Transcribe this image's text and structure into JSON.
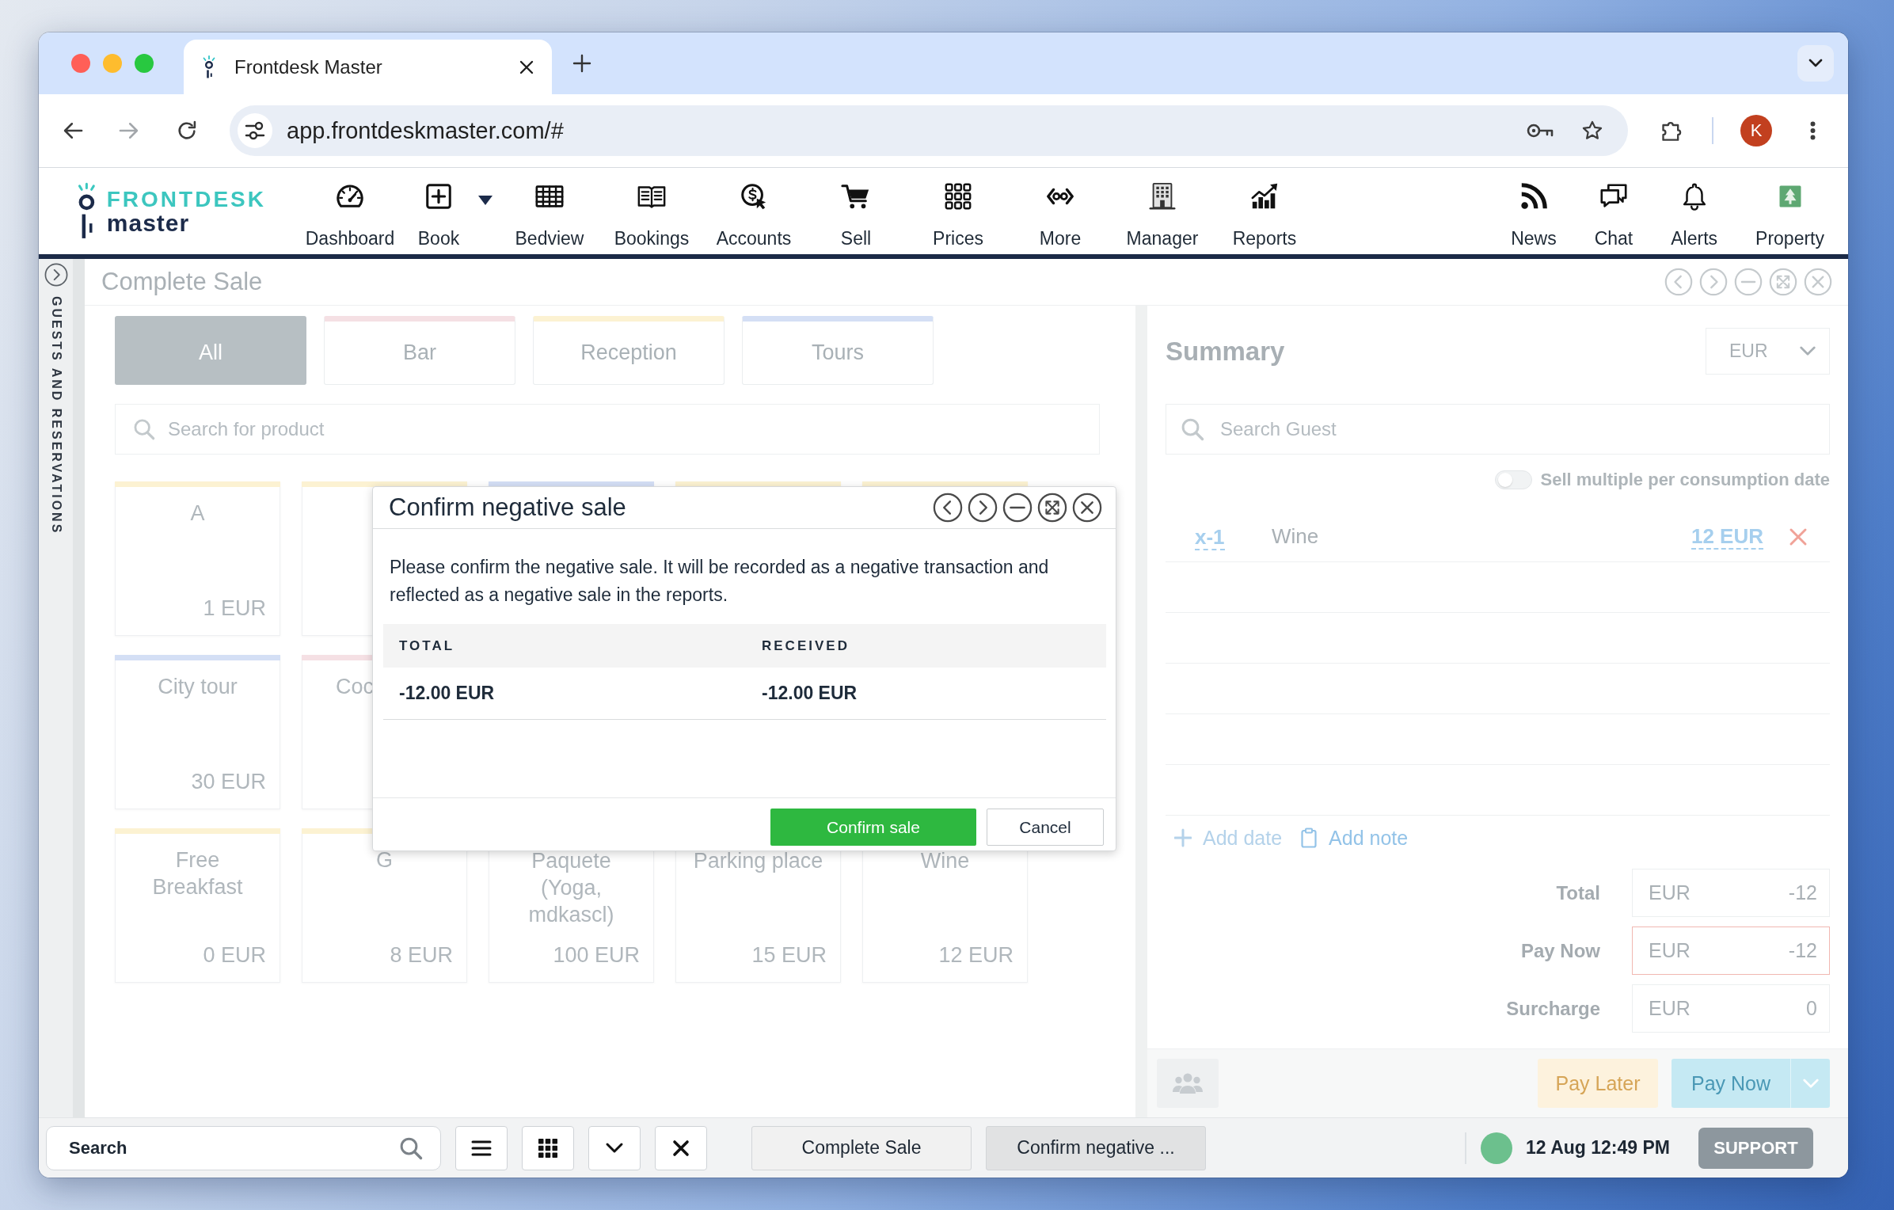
{
  "browser": {
    "tabs": [
      {
        "title": "Frontdesk Master",
        "selected": true
      }
    ],
    "url": "app.frontdeskmaster.com/#",
    "profile_initial": "K"
  },
  "navbar": {
    "logo": {
      "name": "FRONTDESK",
      "tagline": "master"
    },
    "items": [
      {
        "label": "Dashboard",
        "dropdown": false
      },
      {
        "label": "Book",
        "dropdown": true
      },
      {
        "label": "Bedview",
        "dropdown": false
      },
      {
        "label": "Bookings",
        "dropdown": false
      },
      {
        "label": "Accounts",
        "dropdown": false
      },
      {
        "label": "Sell",
        "dropdown": false
      },
      {
        "label": "Prices",
        "dropdown": false
      },
      {
        "label": "More",
        "dropdown": false
      },
      {
        "label": "Manager",
        "dropdown": false
      },
      {
        "label": "Reports",
        "dropdown": false
      }
    ],
    "right_items": [
      {
        "label": "News"
      },
      {
        "label": "Chat"
      },
      {
        "label": "Alerts"
      },
      {
        "label": "Property"
      }
    ]
  },
  "sidebar": {
    "label": "GUESTS AND RESERVATIONS"
  },
  "sale_panel": {
    "title": "Complete Sale",
    "categories": [
      {
        "label": "All",
        "selected": true
      },
      {
        "label": "Bar",
        "selected": false,
        "color": "#f5e0e4"
      },
      {
        "label": "Reception",
        "selected": false,
        "color": "#fcf2d2"
      },
      {
        "label": "Tours",
        "selected": false,
        "color": "#d4dff5"
      }
    ],
    "search": {
      "placeholder": "Search for product"
    },
    "product_rows": [
      [
        {
          "name": "A",
          "price": "1 EUR",
          "color": "#fcf2d2"
        },
        {
          "color": "#fcf2d2"
        },
        {
          "color": "#d4dff5"
        },
        {
          "color": "#fcf2d2"
        },
        {
          "color": "#fcf2d2"
        }
      ],
      [
        {
          "name": "City tour",
          "price": "30 EUR",
          "color": "#d4dff5"
        },
        {
          "name": "Coc",
          "color": "#f5e0e4"
        }
      ],
      [
        {
          "name": "Free Breakfast",
          "price": "0 EUR",
          "color": "#fcf2d2"
        },
        {
          "name": "G",
          "price": "8 EUR",
          "color": "#fcf2d2"
        },
        {
          "name": "Paquete (Yoga, mdkascl)",
          "price": "100 EUR"
        },
        {
          "name": "Parking place",
          "price": "15 EUR"
        },
        {
          "name": "Wine",
          "price": "12 EUR"
        }
      ]
    ]
  },
  "summary": {
    "title": "Summary",
    "currency": "EUR",
    "search": {
      "placeholder": "Search Guest"
    },
    "toggle": {
      "label": "Sell multiple per consumption date",
      "on": false
    },
    "items": [
      {
        "quantity": "x-1",
        "name": "Wine",
        "price": "12 EUR"
      }
    ],
    "actions": [
      {
        "label": "Add date",
        "disabled": true
      },
      {
        "label": "Add note",
        "disabled": false
      }
    ],
    "totals": [
      {
        "label": "Total",
        "currency": "EUR",
        "value": "-12",
        "invalid": false
      },
      {
        "label": "Pay Now",
        "currency": "EUR",
        "value": "-12",
        "invalid": true
      },
      {
        "label": "Surcharge",
        "currency": "EUR",
        "value": "0",
        "invalid": false
      }
    ],
    "buttons": [
      {
        "label": "Pay Later",
        "kind": "later"
      },
      {
        "label": "Pay Now",
        "kind": "pay"
      }
    ]
  },
  "dialog": {
    "title": "Confirm negative sale",
    "message": "Please confirm the negative sale. It will be recorded as a negative transaction and reflected as a negative sale in the reports.",
    "columns": [
      "TOTAL",
      "RECEIVED"
    ],
    "rows": [
      [
        "-12.00 EUR",
        "-12.00 EUR"
      ]
    ],
    "buttons": [
      {
        "label": "Confirm sale",
        "kind": "primary"
      },
      {
        "label": "Cancel",
        "kind": "secondary"
      }
    ]
  },
  "taskbar": {
    "search": {
      "placeholder": "Search"
    },
    "windows": [
      {
        "label": "Complete Sale",
        "selected": false
      },
      {
        "label": "Confirm negative ...",
        "selected": true
      }
    ],
    "online": true,
    "datetime": "12 Aug 12:49 PM",
    "support": "SUPPORT"
  }
}
